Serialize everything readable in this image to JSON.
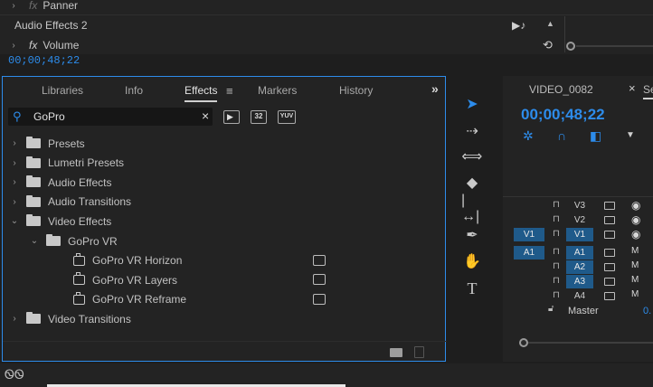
{
  "effect_controls": {
    "panner_label": "Panner",
    "audio_effects_label": "Audio Effects 2",
    "volume_label": "Volume",
    "fx_symbol": "fx",
    "timecode": "00;00;48;22"
  },
  "effects_panel": {
    "tabs": [
      "Libraries",
      "Info",
      "Effects",
      "Markers",
      "History"
    ],
    "active_tab": "Effects",
    "overflow": "»",
    "search": {
      "value": "GoPro"
    },
    "filter_labels": [
      "32",
      "YUV"
    ],
    "tree": [
      {
        "label": "Presets",
        "level": 0,
        "expanded": false,
        "kind": "preset-folder"
      },
      {
        "label": "Lumetri Presets",
        "level": 0,
        "expanded": false,
        "kind": "preset-folder"
      },
      {
        "label": "Audio Effects",
        "level": 0,
        "expanded": false,
        "kind": "folder"
      },
      {
        "label": "Audio Transitions",
        "level": 0,
        "expanded": false,
        "kind": "folder"
      },
      {
        "label": "Video Effects",
        "level": 0,
        "expanded": true,
        "kind": "folder"
      },
      {
        "label": "GoPro VR",
        "level": 1,
        "expanded": true,
        "kind": "folder"
      },
      {
        "label": "GoPro VR Horizon",
        "level": 2,
        "kind": "effect"
      },
      {
        "label": "GoPro VR Layers",
        "level": 2,
        "kind": "effect"
      },
      {
        "label": "GoPro VR Reframe",
        "level": 2,
        "kind": "effect"
      },
      {
        "label": "Video Transitions",
        "level": 0,
        "expanded": false,
        "kind": "folder"
      }
    ]
  },
  "timeline": {
    "sequence_tab": "VIDEO_0082",
    "timecode": "00;00;48;22",
    "close": "×",
    "next_tab": "Se",
    "tracks": [
      {
        "src": "",
        "name": "V3",
        "toggle": "eye"
      },
      {
        "src": "",
        "name": "V2",
        "toggle": "eye"
      },
      {
        "src": "V1",
        "name": "V1",
        "toggle": "eye"
      },
      {
        "src": "A1",
        "name": "A1",
        "toggle": "M"
      },
      {
        "src": "",
        "name": "A2",
        "toggle": "M"
      },
      {
        "src": "",
        "name": "A3",
        "toggle": "M"
      },
      {
        "src": "",
        "name": "A4",
        "toggle": "M"
      }
    ],
    "master_label": "Master",
    "master_value": "0."
  },
  "colors": {
    "accent": "#2d8ceb",
    "track_blue": "#1f5a8a"
  }
}
